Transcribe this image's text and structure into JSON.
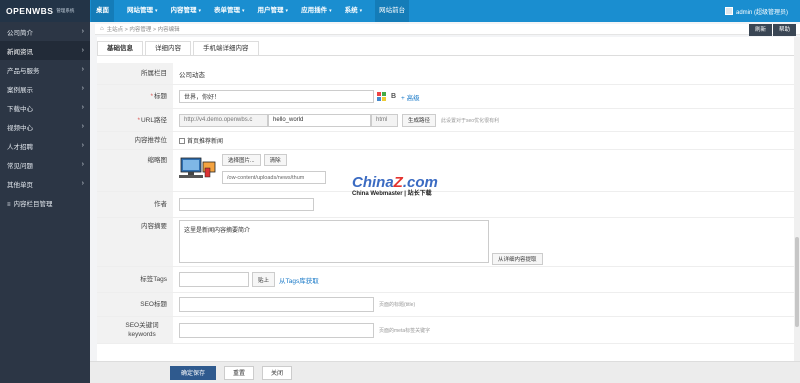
{
  "header": {
    "logo": "OPENWBS",
    "logo_sub": "管理系统",
    "nav": [
      {
        "label": "桌面",
        "active": true,
        "caret": false
      },
      {
        "label": "网站管理",
        "caret": true
      },
      {
        "label": "内容管理",
        "caret": true
      },
      {
        "label": "表单管理",
        "caret": true
      },
      {
        "label": "用户管理",
        "caret": true
      },
      {
        "label": "应用插件",
        "caret": true
      },
      {
        "label": "系统",
        "caret": true
      }
    ],
    "site_front": "网站前台",
    "user": "admin (超级管理员)"
  },
  "sidebar": {
    "items": [
      {
        "label": "公司简介",
        "chev": "›"
      },
      {
        "label": "新闻资讯",
        "chev": "›",
        "active": true
      },
      {
        "label": "产品与服务",
        "chev": "›"
      },
      {
        "label": "案例展示",
        "chev": "›"
      },
      {
        "label": "下载中心",
        "chev": "›"
      },
      {
        "label": "视频中心",
        "chev": "›"
      },
      {
        "label": "人才招聘",
        "chev": "›"
      },
      {
        "label": "常见问题",
        "chev": "›"
      },
      {
        "label": "其他单页",
        "chev": "›"
      },
      {
        "label": "内容栏目管理",
        "chev": "",
        "icon": "≡"
      }
    ]
  },
  "breadcrumb": {
    "text": "主站点 > 内容管理 > 内容编辑"
  },
  "tools": {
    "refresh": "刷新",
    "help": "帮助"
  },
  "tabs": [
    "基础信息",
    "详细内容",
    "手机端详细内容"
  ],
  "form": {
    "category_label": "所属栏目",
    "category_value": "公司动态",
    "title_label": "标题",
    "title_value": "世界，你好！",
    "title_bold": "B",
    "title_advanced": "+ 高级",
    "url_label": "URL路径",
    "url_prefix": "http://v4.demo.openwbs.c",
    "url_value": "hello_world",
    "url_suffix": "html",
    "url_button": "生成路径",
    "url_hint": "此设置对于seo优化很有利",
    "recommend_label": "内容推荐位",
    "recommend_option": "首页推荐新闻",
    "thumb_label": "缩略图",
    "thumb_select": "选择图片...",
    "thumb_clear": "清除",
    "thumb_path": "/ow-content/uploads/news/thum",
    "author_label": "作者",
    "author_value": "",
    "summary_label": "内容摘要",
    "summary_value": "这里是新闻内容摘要简介",
    "summary_button": "从详细内容提取",
    "tags_label": "标签Tags",
    "tags_value": "",
    "tags_paste": "贴上",
    "tags_link": "从Tags库获取",
    "seo_title_label": "SEO标题",
    "seo_title_hint": "页面的标题(title)",
    "seo_kw_label": "SEO关键词keywords",
    "seo_kw_hint": "页面的meta标签关键字"
  },
  "footer": {
    "save": "确定保存",
    "reset": "重置",
    "close": "关闭"
  },
  "watermark": {
    "brand_a": "China",
    "brand_z": "Z",
    "brand_b": ".com",
    "sub": "China Webmaster | 站长下载"
  }
}
